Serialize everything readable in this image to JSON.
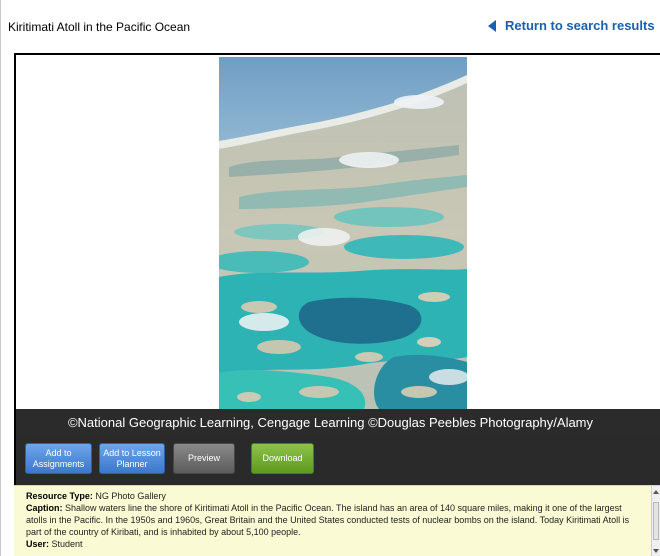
{
  "header": {
    "title": "Kiritimati Atoll in the Pacific Ocean",
    "return_link": "Return to search results"
  },
  "viewer": {
    "image_icon": "aerial-atoll-photo",
    "credit": "©National Geographic Learning, Cengage Learning  ©Douglas Peebles Photography/Alamy"
  },
  "toolbar": {
    "add_assignments": "Add to Assignments",
    "add_lesson_planner": "Add to Lesson Planner",
    "preview": "Preview",
    "download": "Download"
  },
  "details": {
    "resource_type_label": "Resource Type:",
    "resource_type_value": "NG Photo Gallery",
    "caption_label": "Caption:",
    "caption_value": "Shallow waters line the shore of Kiritimati Atoll in the Pacific Ocean. The island has an area of 140 square miles, making it one of the largest atolls in the Pacific. In the 1950s and 1960s, Great Britain and the United States conducted tests of nuclear bombs on the island. Today Kiritimati Atoll is part of the country of Kiribati, and is inhabited by about 5,100 people.",
    "user_label": "User:",
    "user_value": "Student"
  },
  "colors": {
    "link": "#1b5fb0",
    "blue_button": "#4a86d6",
    "gray_button": "#6e6e6e",
    "green_button": "#6fab2c",
    "details_bg": "#fafad4"
  }
}
